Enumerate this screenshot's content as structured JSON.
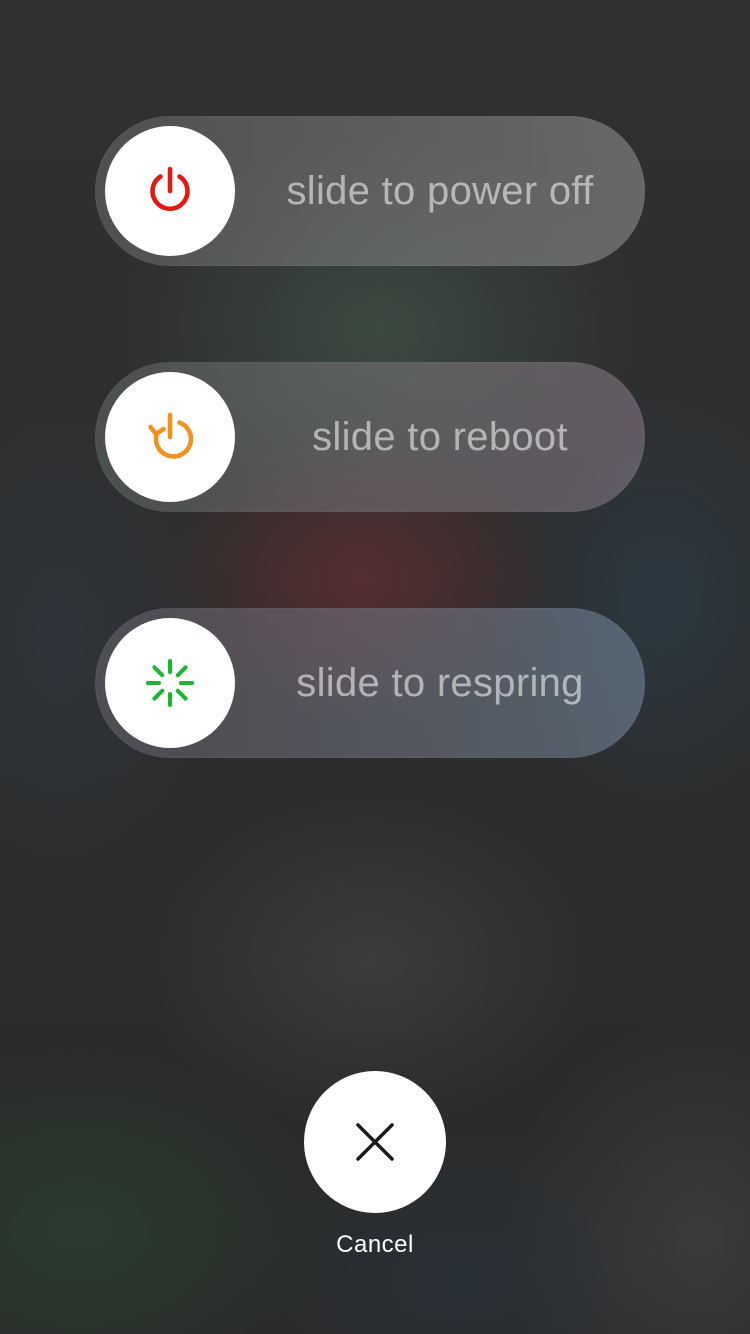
{
  "sliders": [
    {
      "id": "power-off",
      "label": "slide to power off",
      "icon": "power-icon",
      "icon_color": "#e8160f"
    },
    {
      "id": "reboot",
      "label": "slide to reboot",
      "icon": "reboot-icon",
      "icon_color": "#f5901c"
    },
    {
      "id": "respring",
      "label": "slide to respring",
      "icon": "respring-spinner-icon",
      "icon_color": "#18b82c"
    }
  ],
  "cancel": {
    "label": "Cancel",
    "icon": "close-icon",
    "icon_color": "#1a1a1a"
  }
}
